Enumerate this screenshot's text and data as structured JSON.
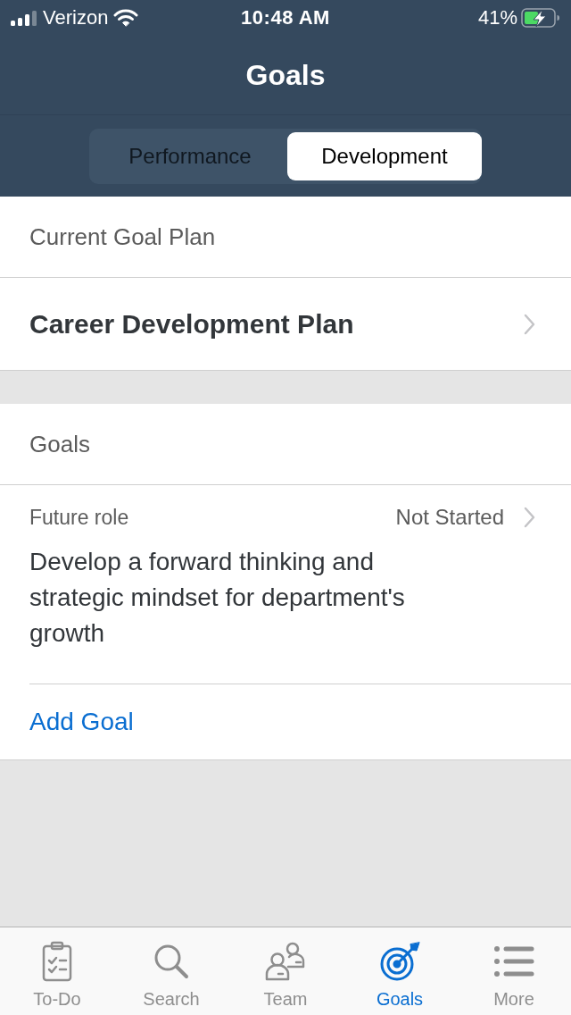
{
  "status_bar": {
    "carrier": "Verizon",
    "time": "10:48 AM",
    "battery": "41%",
    "charging": true
  },
  "header": {
    "title": "Goals"
  },
  "segments": [
    {
      "label": "Performance",
      "selected": false
    },
    {
      "label": "Development",
      "selected": true
    }
  ],
  "plan_section": {
    "heading": "Current Goal Plan",
    "plan": "Career Development Plan"
  },
  "goals_section": {
    "heading": "Goals",
    "goals": [
      {
        "category": "Future role",
        "status": "Not Started",
        "description": "Develop a forward thinking and strategic mindset for department's growth"
      }
    ],
    "add_link": "Add Goal"
  },
  "tab_bar": [
    {
      "kind": "clipboard",
      "label": "To-Do",
      "selected": false
    },
    {
      "kind": "search",
      "label": "Search",
      "selected": false
    },
    {
      "kind": "team",
      "label": "Team",
      "selected": false
    },
    {
      "kind": "target",
      "label": "Goals",
      "selected": true
    },
    {
      "kind": "list",
      "label": "More",
      "selected": false
    }
  ]
}
